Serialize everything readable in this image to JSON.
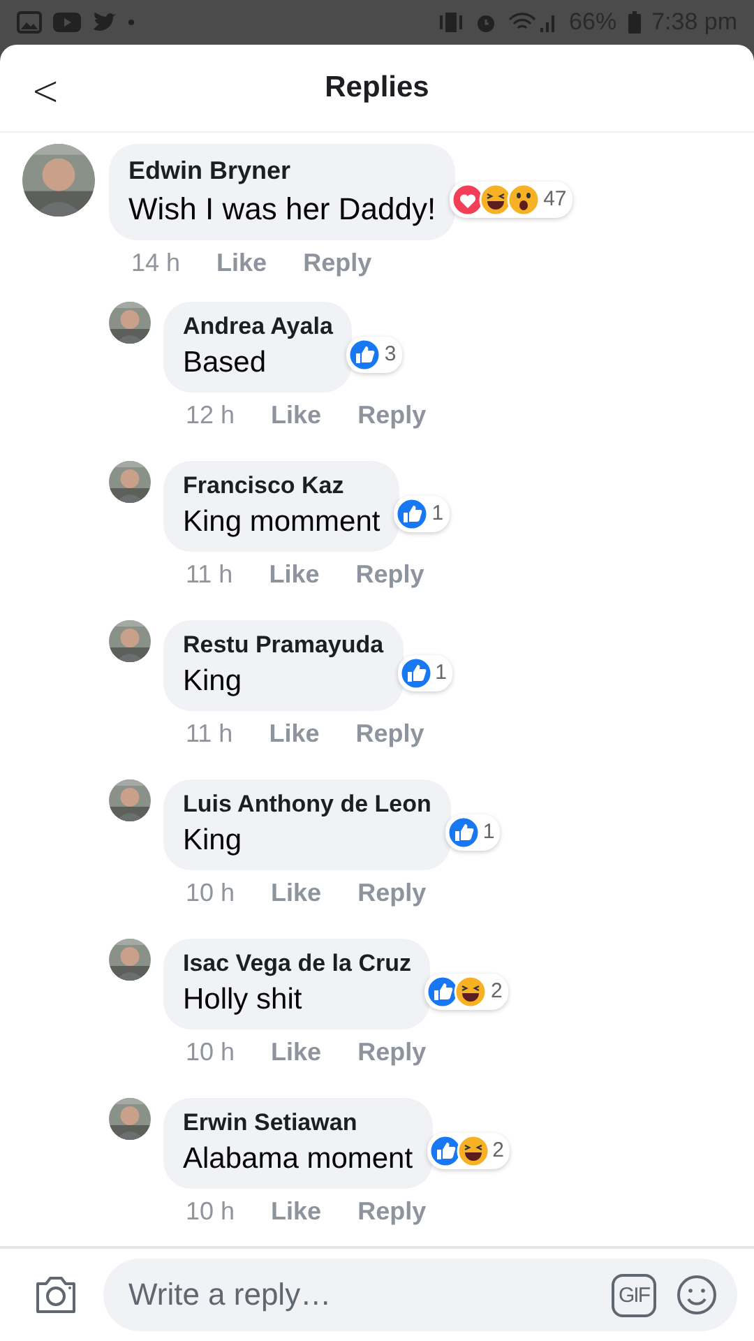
{
  "status_bar": {
    "battery": "66%",
    "time": "7:38 pm"
  },
  "header": {
    "back": "<",
    "title": "Replies"
  },
  "comment": {
    "author": "Edwin Bryner",
    "text": "Wish I was her Daddy!",
    "reactions": [
      {
        "kind": "love"
      },
      {
        "kind": "haha"
      },
      {
        "kind": "wow"
      }
    ],
    "count": "47",
    "time": "14 h",
    "like": "Like",
    "reply": "Reply"
  },
  "replies": [
    {
      "author": "Andrea Ayala",
      "text": "Based",
      "reactions": [
        {
          "kind": "like"
        }
      ],
      "count": "3",
      "time": "12 h",
      "like": "Like",
      "reply": "Reply"
    },
    {
      "author": "Francisco Kaz",
      "text": "King momment",
      "reactions": [
        {
          "kind": "like"
        }
      ],
      "count": "1",
      "time": "11 h",
      "like": "Like",
      "reply": "Reply"
    },
    {
      "author": "Restu Pramayuda",
      "text": "King",
      "reactions": [
        {
          "kind": "like"
        }
      ],
      "count": "1",
      "time": "11 h",
      "like": "Like",
      "reply": "Reply"
    },
    {
      "author": "Luis Anthony de Leon",
      "text": "King",
      "reactions": [
        {
          "kind": "like"
        }
      ],
      "count": "1",
      "time": "10 h",
      "like": "Like",
      "reply": "Reply"
    },
    {
      "author": "Isac Vega de la Cruz",
      "text": "Holly shit",
      "reactions": [
        {
          "kind": "like"
        },
        {
          "kind": "haha"
        }
      ],
      "count": "2",
      "time": "10 h",
      "like": "Like",
      "reply": "Reply"
    },
    {
      "author": "Erwin Setiawan",
      "text": "Alabama moment",
      "reactions": [
        {
          "kind": "like"
        },
        {
          "kind": "haha"
        }
      ],
      "count": "2",
      "time": "10 h",
      "like": "Like",
      "reply": "Reply"
    }
  ],
  "composer": {
    "placeholder": "Write a reply…",
    "gif": "GIF"
  }
}
